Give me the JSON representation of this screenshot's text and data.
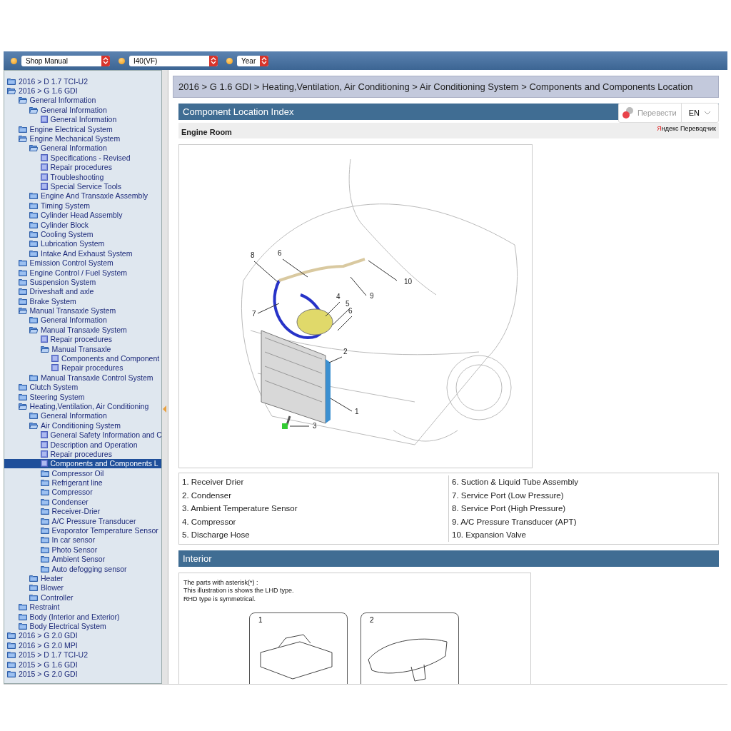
{
  "toolbar": {
    "selects": [
      {
        "value": "Shop Manual"
      },
      {
        "value": "I40(VF)"
      },
      {
        "value": "Year"
      }
    ]
  },
  "tree": [
    {
      "label": "2016 > D 1.7 TCI-U2",
      "kind": "folder",
      "expanded": false,
      "selected": false
    },
    {
      "label": "2016 > G 1.6 GDI",
      "kind": "folder",
      "expanded": true,
      "selected": false,
      "children": [
        {
          "label": "General Information",
          "kind": "folder",
          "expanded": true,
          "selected": false,
          "children": [
            {
              "label": "General Information",
              "kind": "folder",
              "expanded": true,
              "selected": false,
              "children": [
                {
                  "label": "General Information",
                  "kind": "page",
                  "selected": false
                }
              ]
            }
          ]
        },
        {
          "label": "Engine Electrical System",
          "kind": "folder",
          "expanded": false,
          "selected": false
        },
        {
          "label": "Engine Mechanical System",
          "kind": "folder",
          "expanded": true,
          "selected": false,
          "children": [
            {
              "label": "General Information",
              "kind": "folder",
              "expanded": true,
              "selected": false,
              "children": [
                {
                  "label": "Specifications - Revised",
                  "kind": "page",
                  "selected": false
                },
                {
                  "label": "Repair procedures",
                  "kind": "page",
                  "selected": false
                },
                {
                  "label": "Troubleshooting",
                  "kind": "page",
                  "selected": false
                },
                {
                  "label": "Special Service Tools",
                  "kind": "page",
                  "selected": false
                }
              ]
            },
            {
              "label": "Engine And Transaxle Assembly",
              "kind": "folder",
              "expanded": false,
              "selected": false
            },
            {
              "label": "Timing System",
              "kind": "folder",
              "expanded": false,
              "selected": false
            },
            {
              "label": "Cylinder Head Assembly",
              "kind": "folder",
              "expanded": false,
              "selected": false
            },
            {
              "label": "Cylinder Block",
              "kind": "folder",
              "expanded": false,
              "selected": false
            },
            {
              "label": "Cooling System",
              "kind": "folder",
              "expanded": false,
              "selected": false
            },
            {
              "label": "Lubrication System",
              "kind": "folder",
              "expanded": false,
              "selected": false
            },
            {
              "label": "Intake And Exhaust System",
              "kind": "folder",
              "expanded": false,
              "selected": false
            }
          ]
        },
        {
          "label": "Emission Control System",
          "kind": "folder",
          "expanded": false,
          "selected": false
        },
        {
          "label": "Engine Control / Fuel System",
          "kind": "folder",
          "expanded": false,
          "selected": false
        },
        {
          "label": "Suspension System",
          "kind": "folder",
          "expanded": false,
          "selected": false
        },
        {
          "label": "Driveshaft and axle",
          "kind": "folder",
          "expanded": false,
          "selected": false
        },
        {
          "label": "Brake System",
          "kind": "folder",
          "expanded": false,
          "selected": false
        },
        {
          "label": "Manual Transaxle System",
          "kind": "folder",
          "expanded": true,
          "selected": false,
          "children": [
            {
              "label": "General Information",
              "kind": "folder",
              "expanded": false,
              "selected": false
            },
            {
              "label": "Manual Transaxle System",
              "kind": "folder",
              "expanded": true,
              "selected": false,
              "children": [
                {
                  "label": "Repair procedures",
                  "kind": "page",
                  "selected": false
                },
                {
                  "label": "Manual Transaxle",
                  "kind": "folder",
                  "expanded": true,
                  "selected": false,
                  "children": [
                    {
                      "label": "Components and Component",
                      "kind": "page",
                      "selected": false
                    },
                    {
                      "label": "Repair procedures",
                      "kind": "page",
                      "selected": false
                    }
                  ]
                }
              ]
            },
            {
              "label": "Manual Transaxle Control System",
              "kind": "folder",
              "expanded": false,
              "selected": false
            }
          ]
        },
        {
          "label": "Clutch System",
          "kind": "folder",
          "expanded": false,
          "selected": false
        },
        {
          "label": "Steering System",
          "kind": "folder",
          "expanded": false,
          "selected": false
        },
        {
          "label": "Heating,Ventilation, Air Conditioning",
          "kind": "folder",
          "expanded": true,
          "selected": false,
          "children": [
            {
              "label": "General Information",
              "kind": "folder",
              "expanded": false,
              "selected": false
            },
            {
              "label": "Air Conditioning System",
              "kind": "folder",
              "expanded": true,
              "selected": false,
              "children": [
                {
                  "label": "General Safety Information and C",
                  "kind": "page",
                  "selected": false
                },
                {
                  "label": "Description and Operation",
                  "kind": "page",
                  "selected": false
                },
                {
                  "label": "Repair procedures",
                  "kind": "page",
                  "selected": false
                },
                {
                  "label": "Components and Components L",
                  "kind": "page",
                  "selected": true
                },
                {
                  "label": "Compressor Oil",
                  "kind": "folder",
                  "expanded": false,
                  "selected": false
                },
                {
                  "label": "Refrigerant line",
                  "kind": "folder",
                  "expanded": false,
                  "selected": false
                },
                {
                  "label": "Compressor",
                  "kind": "folder",
                  "expanded": false,
                  "selected": false
                },
                {
                  "label": "Condenser",
                  "kind": "folder",
                  "expanded": false,
                  "selected": false
                },
                {
                  "label": "Receiver-Drier",
                  "kind": "folder",
                  "expanded": false,
                  "selected": false
                },
                {
                  "label": "A/C Pressure Transducer",
                  "kind": "folder",
                  "expanded": false,
                  "selected": false
                },
                {
                  "label": "Evaporator Temperature Sensor",
                  "kind": "folder",
                  "expanded": false,
                  "selected": false
                },
                {
                  "label": "In car sensor",
                  "kind": "folder",
                  "expanded": false,
                  "selected": false
                },
                {
                  "label": "Photo Sensor",
                  "kind": "folder",
                  "expanded": false,
                  "selected": false
                },
                {
                  "label": "Ambient Sensor",
                  "kind": "folder",
                  "expanded": false,
                  "selected": false
                },
                {
                  "label": "Auto defogging sensor",
                  "kind": "folder",
                  "expanded": false,
                  "selected": false
                }
              ]
            },
            {
              "label": "Heater",
              "kind": "folder",
              "expanded": false,
              "selected": false
            },
            {
              "label": "Blower",
              "kind": "folder",
              "expanded": false,
              "selected": false
            },
            {
              "label": "Controller",
              "kind": "folder",
              "expanded": false,
              "selected": false
            }
          ]
        },
        {
          "label": "Restraint",
          "kind": "folder",
          "expanded": false,
          "selected": false
        },
        {
          "label": "Body (Interior and Exterior)",
          "kind": "folder",
          "expanded": false,
          "selected": false
        },
        {
          "label": "Body Electrical System",
          "kind": "folder",
          "expanded": false,
          "selected": false
        }
      ]
    },
    {
      "label": "2016 > G 2.0 GDI",
      "kind": "folder",
      "expanded": false,
      "selected": false
    },
    {
      "label": "2016 > G 2.0 MPI",
      "kind": "folder",
      "expanded": false,
      "selected": false
    },
    {
      "label": "2015 > D 1.7 TCI-U2",
      "kind": "folder",
      "expanded": false,
      "selected": false
    },
    {
      "label": "2015 > G 1.6 GDI",
      "kind": "folder",
      "expanded": false,
      "selected": false
    },
    {
      "label": "2015 > G 2.0 GDI",
      "kind": "folder",
      "expanded": false,
      "selected": false
    }
  ],
  "breadcrumb": "2016 > G 1.6 GDI > Heating,Ventilation, Air Conditioning > Air Conditioning System > Components and Components Location",
  "translator": {
    "button": "Перевести",
    "language": "EN",
    "brand": "Яндекс Переводчик"
  },
  "sections": [
    {
      "title": "Component Location Index",
      "subtitle": "Engine Room",
      "callouts": [
        "8",
        "6",
        "10",
        "9",
        "4",
        "5",
        "6",
        "7",
        "2",
        "1",
        "3"
      ],
      "legend": [
        [
          "1. Receiver Drier",
          "2. Condenser",
          "3. Ambient Temperature Sensor",
          "4. Compressor",
          "5. Discharge Hose"
        ],
        [
          "6. Suction & Liquid Tube Assembly",
          "7. Service Port (Low Pressure)",
          "8. Service Port (High Pressure)",
          "9. A/C Pressure Transducer (APT)",
          "10. Expansion Valve"
        ]
      ]
    },
    {
      "title": "Interior",
      "note": [
        "The parts with asterisk(*) :",
        "This illustration is shows the LHD type.",
        "RHD type is symmetrical."
      ],
      "callouts": [
        "1",
        "2"
      ]
    }
  ]
}
